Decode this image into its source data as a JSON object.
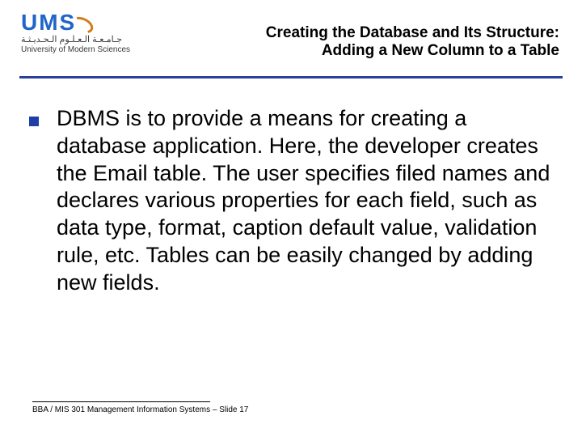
{
  "logo": {
    "abbr": "UMS",
    "arabic": "جـامـعـة الـعـلـوم الـحـديـثـة",
    "english": "University of Modern Sciences"
  },
  "title": {
    "line1": "Creating the Database and Its Structure:",
    "line2": "Adding a New Column to a Table"
  },
  "body": {
    "bullet1": "DBMS is to provide a means for creating a database application. Here, the developer creates the Email table. The user specifies filed names and declares various properties for each field, such as data type, format, caption default value, validation rule, etc. Tables can be easily changed by adding new fields."
  },
  "footer": {
    "text": "BBA / MIS 301 Management Information Systems – Slide 17"
  }
}
